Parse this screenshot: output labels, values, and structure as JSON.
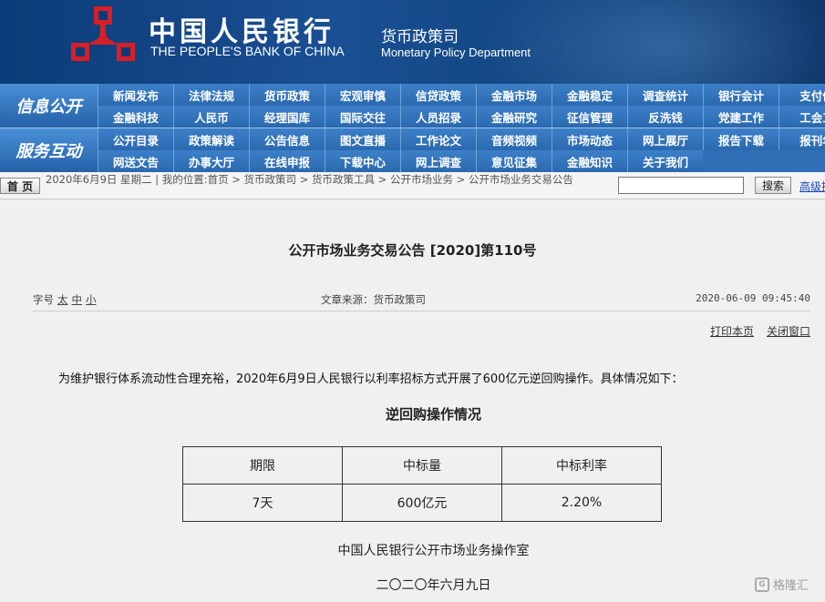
{
  "header": {
    "bank_name_cn": "中国人民银行",
    "bank_name_en": "THE PEOPLE'S BANK OF CHINA",
    "dept_cn": "货币政策司",
    "dept_en": "Monetary Policy Department"
  },
  "nav": {
    "group1_label": "信息公开",
    "group2_label": "服务互动",
    "row1": [
      "新闻发布",
      "法律法规",
      "货币政策",
      "宏观审慎",
      "信贷政策",
      "金融市场",
      "金融稳定",
      "调查统计",
      "银行会计",
      "支付体"
    ],
    "row2": [
      "金融科技",
      "人民币",
      "经理国库",
      "国际交往",
      "人员招录",
      "金融研究",
      "征信管理",
      "反洗钱",
      "党建工作",
      "工会工"
    ],
    "row3": [
      "公开目录",
      "政策解读",
      "公告信息",
      "图文直播",
      "工作论文",
      "音频视频",
      "市场动态",
      "网上展厅",
      "报告下载",
      "报刊年"
    ],
    "row4": [
      "网送文告",
      "办事大厅",
      "在线申报",
      "下载中心",
      "网上调查",
      "意见征集",
      "金融知识",
      "关于我们"
    ]
  },
  "crumb": {
    "home": "首 页",
    "text": "2020年6月9日 星期二 | 我的位置:首页  >  货币政策司  >  货币政策工具  >  公开市场业务  >  公开市场业务交易公告",
    "search_placeholder": "",
    "search_label": "搜索",
    "advanced": "高级搜"
  },
  "article": {
    "title": "公开市场业务交易公告 [2020]第110号",
    "font_size_label": "字号",
    "font_large": "太",
    "font_medium": "中",
    "font_small": "小",
    "source": "文章来源：货币政策司",
    "datetime": "2020-06-09  09:45:40",
    "print": "打印本页",
    "close": "关闭窗口",
    "body": "为维护银行体系流动性合理充裕，2020年6月9日人民银行以利率招标方式开展了600亿元逆回购操作。具体情况如下：",
    "table_title": "逆回购操作情况",
    "table_headers": [
      "期限",
      "中标量",
      "中标利率"
    ],
    "table_row": [
      "7天",
      "600亿元",
      "2.20%"
    ],
    "footer_org": "中国人民银行公开市场业务操作室",
    "footer_date": "二〇二〇年六月九日"
  },
  "watermark": {
    "text": "格隆汇",
    "badge": "G"
  },
  "colors": {
    "banner": "#1a4f93",
    "nav": "#2e6fb6",
    "logo": "#d61f26"
  }
}
